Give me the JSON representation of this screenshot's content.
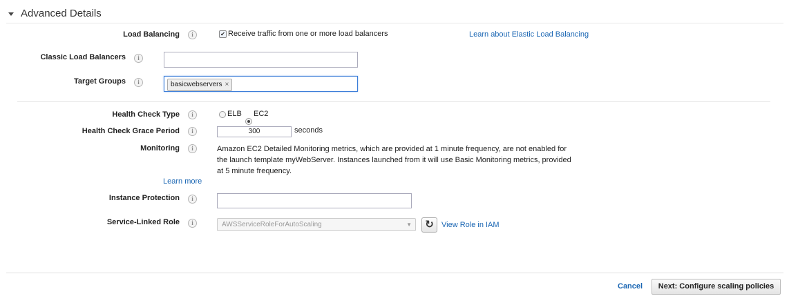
{
  "section": {
    "title": "Advanced Details"
  },
  "load_balancing": {
    "label": "Load Balancing",
    "checkbox_label": "Receive traffic from one or more load balancers",
    "checked": true,
    "learn_link": "Learn about Elastic Load Balancing"
  },
  "classic_lb": {
    "label": "Classic Load Balancers",
    "value": ""
  },
  "target_groups": {
    "label": "Target Groups",
    "tags": [
      "basicwebservers"
    ],
    "remove_glyph": "×"
  },
  "health_check_type": {
    "label": "Health Check Type",
    "options": [
      "ELB",
      "EC2"
    ],
    "selected": "EC2"
  },
  "grace_period": {
    "label": "Health Check Grace Period",
    "value": "300",
    "unit": "seconds"
  },
  "monitoring": {
    "label": "Monitoring",
    "line1": "Amazon EC2 Detailed Monitoring metrics, which are provided at 1 minute frequency, are not enabled for",
    "line2": "the launch template myWebServer. Instances launched from it will use Basic Monitoring metrics, provided",
    "line3": "at 5 minute frequency.",
    "learn_more": "Learn more"
  },
  "instance_protection": {
    "label": "Instance Protection",
    "value": ""
  },
  "service_role": {
    "label": "Service-Linked Role",
    "value": "AWSServiceRoleForAutoScaling",
    "refresh_glyph": "↻",
    "view_link": "View Role in IAM"
  },
  "footer": {
    "cancel": "Cancel",
    "next": "Next: Configure scaling policies"
  },
  "info_glyph": "i",
  "colors": {
    "link": "#1a66b3",
    "focus_border": "#3b7dd8"
  }
}
